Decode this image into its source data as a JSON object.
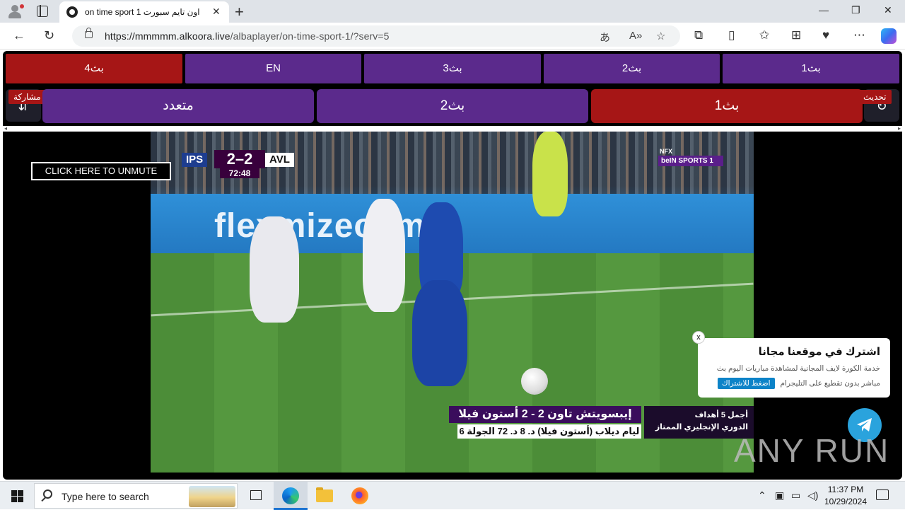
{
  "browser": {
    "tab_title": "on time sport 1 اون تايم سبورت",
    "url_host": "https://mmmmm.alkoora.live",
    "url_path": "/albaplayer/on-time-sport-1/?serv=5"
  },
  "servers_top": [
    "بث4",
    "EN",
    "بث3",
    "بث2",
    "بث1"
  ],
  "servers_top_active": "بث4",
  "servers_main": [
    "متعدد",
    "بث2",
    "بث1"
  ],
  "servers_main_active": "بث1",
  "share_label": "مشاركة",
  "refresh_label": "تحديث",
  "video": {
    "unmute_label": "CLICK HERE TO UNMUTE",
    "score": {
      "home": "IPS",
      "away": "AVL",
      "score": "2–2",
      "time": "72:48"
    },
    "channel": "beIN SPORTS 1",
    "channel_tag": "NFX",
    "ad_text": "flexmizecom",
    "lower_third": {
      "headline": "إيبسويتش تاون  2 - 2  أستون فيلا",
      "scorer": "ليام ديلاب (أستون فيلا) د. 8  د. 72  الجولة 6",
      "right_top": "أجمل 5 أهداف",
      "right_bottom": "الدوري الإنجليزي الممتاز"
    }
  },
  "popup": {
    "close": "x",
    "title": "اشترك في موقعنا مجانا",
    "desc_line1": "خدمة الكورة لايف المجانية لمشاهدة مباريات اليوم بث",
    "desc_line2": "مباشر بدون تقطيع على التليجرام",
    "subscribe": "اضغط للاشتراك"
  },
  "watermark": "ANY RUN",
  "taskbar": {
    "search_placeholder": "Type here to search",
    "time": "11:37 PM",
    "date": "10/29/2024"
  }
}
